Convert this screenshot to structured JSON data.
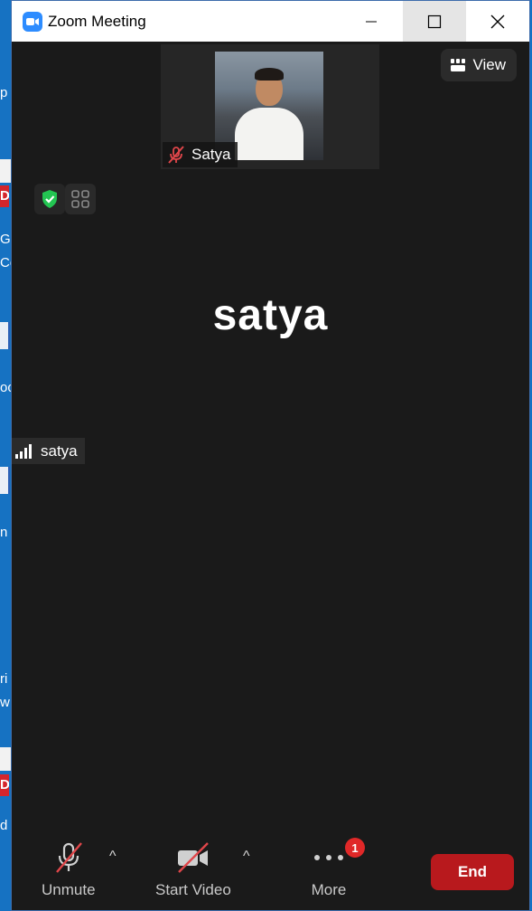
{
  "window": {
    "title": "Zoom Meeting"
  },
  "thumbnail": {
    "participant_name": "Satya",
    "muted": true
  },
  "view_button": {
    "label": "View"
  },
  "active_speaker": {
    "display_name": "satya",
    "name_tag": "satya"
  },
  "toolbar": {
    "unmute_label": "Unmute",
    "start_video_label": "Start Video",
    "more_label": "More",
    "more_badge": "1",
    "end_label": "End"
  },
  "desktop_fragments": [
    "p",
    "D",
    "G",
    "Co",
    "oc",
    "n",
    "ri",
    "w",
    "D",
    "d"
  ],
  "colors": {
    "end_red": "#b8191d",
    "badge_red": "#e02828",
    "zoom_blue": "#2d8cff",
    "shield_green": "#23c552"
  }
}
